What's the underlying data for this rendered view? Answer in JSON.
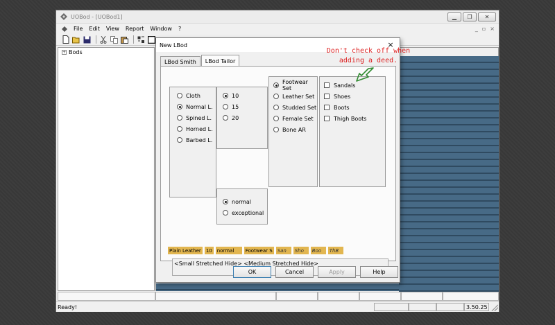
{
  "window": {
    "title": "UOBod - [UOBod1]",
    "menu": [
      "File",
      "Edit",
      "View",
      "Report",
      "Window",
      "?"
    ],
    "mdi_buttons": [
      "_",
      "▫",
      "×"
    ]
  },
  "tree": {
    "root_label": "Bods",
    "expander": "+"
  },
  "status": {
    "text": "Ready!",
    "right_value": "3.50.25"
  },
  "dialog": {
    "title": "New LBod",
    "close": "×",
    "tabs": [
      {
        "label": "LBod Smith",
        "active": false
      },
      {
        "label": "LBod Tailor",
        "active": true
      }
    ],
    "material_group": [
      {
        "label": "Cloth",
        "checked": false
      },
      {
        "label": "Normal L.",
        "checked": true
      },
      {
        "label": "Spined L.",
        "checked": false
      },
      {
        "label": "Horned L.",
        "checked": false
      },
      {
        "label": "Barbed L.",
        "checked": false
      }
    ],
    "amount_group": [
      {
        "label": "10",
        "checked": true
      },
      {
        "label": "15",
        "checked": false
      },
      {
        "label": "20",
        "checked": false
      }
    ],
    "quality_group": [
      {
        "label": "normal",
        "checked": true
      },
      {
        "label": "exceptional",
        "checked": false
      }
    ],
    "set_group": [
      {
        "label": "Footwear Set",
        "checked": true
      },
      {
        "label": "Leather Set",
        "checked": false
      },
      {
        "label": "Studded Set",
        "checked": false
      },
      {
        "label": "Female Set",
        "checked": false
      },
      {
        "label": "Bone AR",
        "checked": false
      }
    ],
    "item_group": [
      {
        "label": "Sandals",
        "checked": false
      },
      {
        "label": "Shoes",
        "checked": false
      },
      {
        "label": "Boots",
        "checked": false
      },
      {
        "label": "Thigh Boots",
        "checked": false
      }
    ],
    "summary": [
      {
        "text": "Plain Leather",
        "italic": false
      },
      {
        "text": "10",
        "italic": false
      },
      {
        "text": "normal",
        "italic": false
      },
      {
        "text": "Footwear S",
        "italic": false
      },
      {
        "text": "San",
        "italic": true
      },
      {
        "text": "Sho",
        "italic": true
      },
      {
        "text": "Boo",
        "italic": true
      },
      {
        "text": "ThB",
        "italic": true
      }
    ],
    "materials_text": "<Small Stretched Hide>  <Medium  Stretched Hide>",
    "buttons": {
      "ok": "OK",
      "cancel": "Cancel",
      "apply": "Apply",
      "help": "Help"
    }
  },
  "annotation": {
    "line1": "Don't check off when",
    "line2": "adding a deed.",
    "color": "#d22222",
    "arrow_color": "#2f8a2f"
  }
}
